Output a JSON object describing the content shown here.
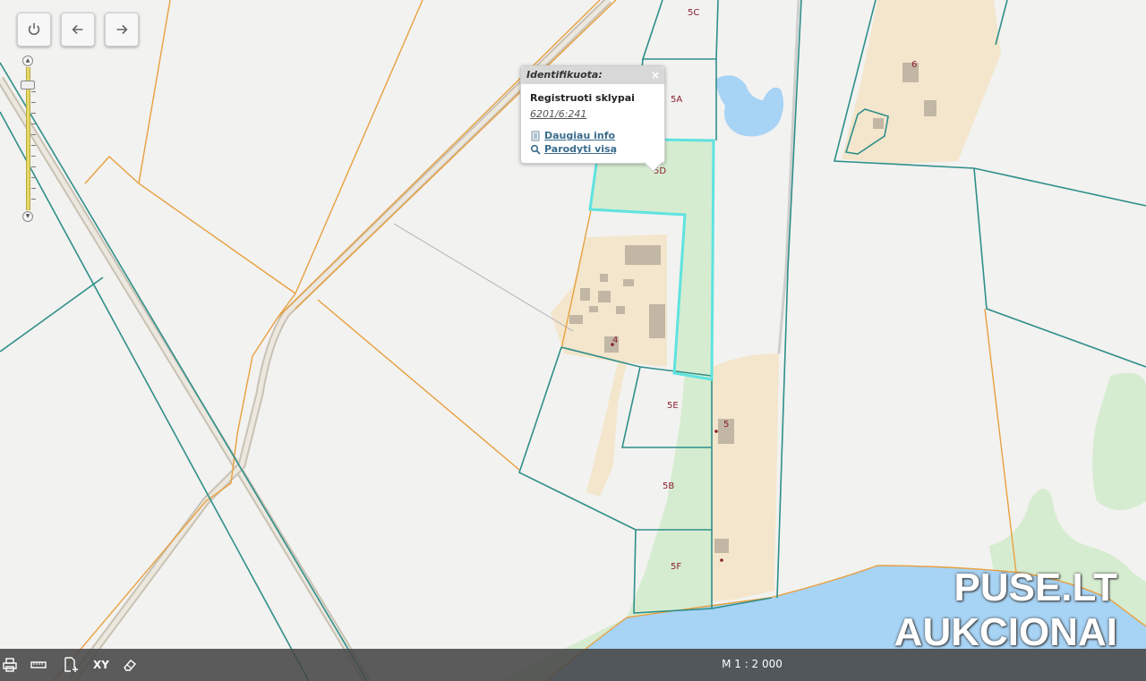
{
  "toolbar": {
    "power_icon": "power-icon",
    "back_icon": "arrow-left-icon",
    "forward_icon": "arrow-right-icon"
  },
  "popup": {
    "title": "Identifikuota:",
    "close": "×",
    "layer": "Registruoti sklypai",
    "parcel_id": "6201/6:241",
    "more_info": "Daugiau info",
    "show_all": "Parodyti visą"
  },
  "plots": {
    "p5c": "5C",
    "p5a": "5A",
    "p5d": "5D",
    "p4": "4",
    "p5e": "5E",
    "p5": "5",
    "p5b": "5B",
    "p5f": "5F",
    "p6": "6"
  },
  "bottom_bar": {
    "xy": "XY",
    "scale": "M 1 : 2 000"
  },
  "watermark": {
    "line1": "PUSE.LT",
    "line2": "AUKCIONAI"
  },
  "colors": {
    "parcel_border": "#2f8f8a",
    "boundary_orange": "#e8a040",
    "selected_parcel": "#5fe3e0",
    "water": "#a7d3f5",
    "green_area": "#d6ecd0",
    "built_area": "#f3e6cc",
    "building": "#c2b6a4"
  }
}
